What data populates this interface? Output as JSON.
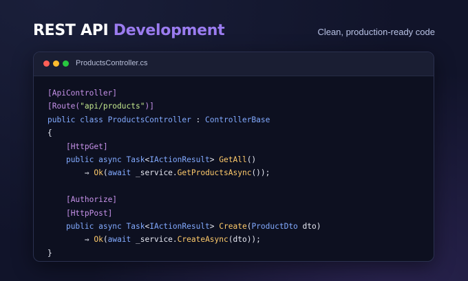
{
  "header": {
    "title_part1": "REST API",
    "title_part2": "Development",
    "subtitle": "Clean, production-ready code"
  },
  "window": {
    "filename": "ProductsController.cs"
  },
  "code": {
    "lines": [
      [
        {
          "t": "[ApiController]",
          "c": "attr"
        }
      ],
      [
        {
          "t": "[Route(",
          "c": "attr"
        },
        {
          "t": "\"api/products\"",
          "c": "str"
        },
        {
          "t": ")]",
          "c": "attr"
        }
      ],
      [
        {
          "t": "public class ",
          "c": "kw"
        },
        {
          "t": "ProductsController",
          "c": "type"
        },
        {
          "t": " : ",
          "c": "punc"
        },
        {
          "t": "ControllerBase",
          "c": "type"
        }
      ],
      [
        {
          "t": "{",
          "c": "punc"
        }
      ],
      [
        {
          "t": "    ",
          "c": "punc"
        },
        {
          "t": "[HttpGet]",
          "c": "attr"
        }
      ],
      [
        {
          "t": "    ",
          "c": "punc"
        },
        {
          "t": "public async ",
          "c": "kw"
        },
        {
          "t": "Task",
          "c": "type"
        },
        {
          "t": "<",
          "c": "punc"
        },
        {
          "t": "IActionResult",
          "c": "type"
        },
        {
          "t": "> ",
          "c": "punc"
        },
        {
          "t": "GetAll",
          "c": "fn"
        },
        {
          "t": "()",
          "c": "punc"
        }
      ],
      [
        {
          "t": "        ",
          "c": "punc"
        },
        {
          "t": "⇒ ",
          "c": "arrow"
        },
        {
          "t": "Ok",
          "c": "fn"
        },
        {
          "t": "(",
          "c": "punc"
        },
        {
          "t": "await",
          "c": "kw"
        },
        {
          "t": " _service.",
          "c": "punc"
        },
        {
          "t": "GetProductsAsync",
          "c": "fn"
        },
        {
          "t": "());",
          "c": "punc"
        }
      ],
      [
        {
          "t": "",
          "c": "punc"
        }
      ],
      [
        {
          "t": "    ",
          "c": "punc"
        },
        {
          "t": "[Authorize]",
          "c": "attr"
        }
      ],
      [
        {
          "t": "    ",
          "c": "punc"
        },
        {
          "t": "[HttpPost]",
          "c": "attr"
        }
      ],
      [
        {
          "t": "    ",
          "c": "punc"
        },
        {
          "t": "public async ",
          "c": "kw"
        },
        {
          "t": "Task",
          "c": "type"
        },
        {
          "t": "<",
          "c": "punc"
        },
        {
          "t": "IActionResult",
          "c": "type"
        },
        {
          "t": "> ",
          "c": "punc"
        },
        {
          "t": "Create",
          "c": "fn"
        },
        {
          "t": "(",
          "c": "punc"
        },
        {
          "t": "ProductDto",
          "c": "type"
        },
        {
          "t": " dto)",
          "c": "punc"
        }
      ],
      [
        {
          "t": "        ",
          "c": "punc"
        },
        {
          "t": "⇒ ",
          "c": "arrow"
        },
        {
          "t": "Ok",
          "c": "fn"
        },
        {
          "t": "(",
          "c": "punc"
        },
        {
          "t": "await",
          "c": "kw"
        },
        {
          "t": " _service.",
          "c": "punc"
        },
        {
          "t": "CreateAsync",
          "c": "fn"
        },
        {
          "t": "(dto));",
          "c": "punc"
        }
      ],
      [
        {
          "t": "}",
          "c": "punc"
        }
      ]
    ]
  },
  "colors": {
    "background": "#11142a",
    "accent": "#9b7cf0",
    "window_bg": "#0d1020",
    "titlebar_bg": "#1a1e33",
    "dot_red": "#ff5f57",
    "dot_yellow": "#febc2e",
    "dot_green": "#28c840",
    "syntax_attribute": "#c792ea",
    "syntax_string": "#c3e88d",
    "syntax_keyword": "#82aaff",
    "syntax_function": "#ffcb6b"
  }
}
